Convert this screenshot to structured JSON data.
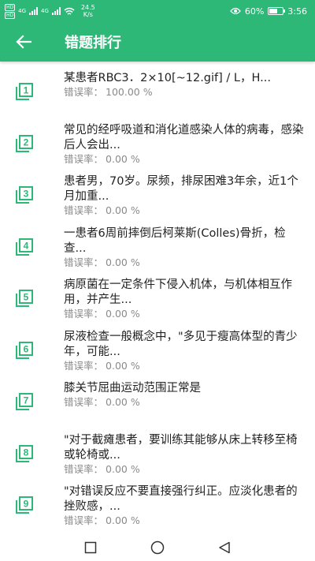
{
  "status": {
    "sim1": "HD",
    "sim2": "HD",
    "net1": "4G",
    "net2": "4G",
    "speed_value": "24.5",
    "speed_unit": "K/s",
    "battery": "60%",
    "battery_level": 0.6,
    "time": "3:56"
  },
  "header": {
    "title": "错题排行"
  },
  "rate_label": "错误率：",
  "items": [
    {
      "num": "1",
      "text": "某患者RBC3．2×10[~12.gif] / L，H...",
      "rate": "100.00 %"
    },
    {
      "num": "2",
      "text": "常见的经呼吸道和消化道感染人体的病毒，感染后人会出...",
      "rate": "0.00 %"
    },
    {
      "num": "3",
      "text": "患者男，70岁。尿频，排尿困难3年余，近1个月加重...",
      "rate": "0.00 %"
    },
    {
      "num": "4",
      "text": "一患者6周前摔倒后柯莱斯(Colles)骨折，检查...",
      "rate": "0.00 %"
    },
    {
      "num": "5",
      "text": "病原菌在一定条件下侵入机体，与机体相互作用，并产生...",
      "rate": "0.00 %"
    },
    {
      "num": "6",
      "text": "尿液检查一般概念中，\"多见于瘦高体型的青少年，可能...",
      "rate": "0.00 %"
    },
    {
      "num": "7",
      "text": "膝关节屈曲运动范围正常是",
      "rate": "0.00 %"
    },
    {
      "num": "8",
      "text": "\"对于截瘫患者，要训练其能够从床上转移至椅或轮椅或...",
      "rate": "0.00 %"
    },
    {
      "num": "9",
      "text": "\"对错误反应不要直接强行纠正。应淡化患者的挫败感，...",
      "rate": "0.00 %"
    }
  ],
  "colors": {
    "brand": "#2db878",
    "icon": "#2db878",
    "text": "#222222",
    "secondary_text": "#8a8a8a"
  }
}
